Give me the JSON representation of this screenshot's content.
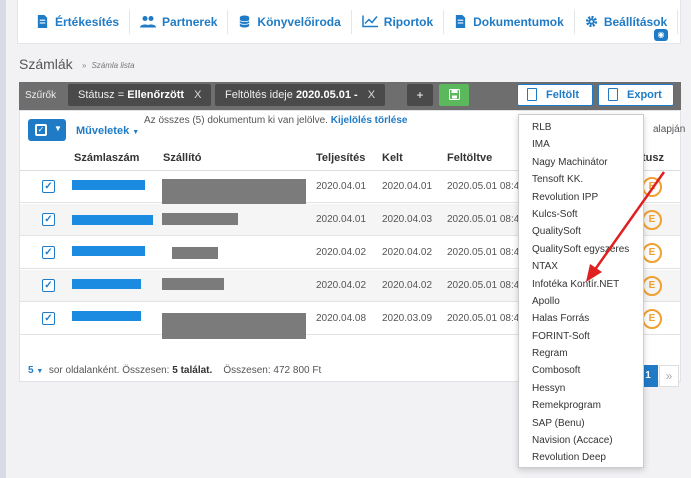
{
  "nav": {
    "items": [
      {
        "label": "Értékesítés",
        "icon": "document-icon"
      },
      {
        "label": "Partnerek",
        "icon": "users-icon"
      },
      {
        "label": "Könyvelőiroda",
        "icon": "database-icon"
      },
      {
        "label": "Riportok",
        "icon": "line-chart-icon"
      },
      {
        "label": "Dokumentumok",
        "icon": "document-icon"
      },
      {
        "label": "Beállítások",
        "icon": "gear-icon"
      }
    ]
  },
  "page": {
    "title": "Számlák",
    "breadcrumb": "Számla lista"
  },
  "filters": {
    "label": "Szűrők",
    "chip1": {
      "prefix": "Státusz = ",
      "value": "Ellenőrzött",
      "close": "X"
    },
    "chip2": {
      "prefix": "Feltöltés ideje ",
      "value": "2020.05.01 -",
      "close": "X"
    },
    "plus": "+",
    "upload_label": "Feltölt",
    "export_label": "Export"
  },
  "toolbar": {
    "actions_label": "Műveletek",
    "selection_info": "Az összes (5) dokumentum ki van jelölve.",
    "clear_selection": "Kijelölés törlése",
    "tail_text": "alapján"
  },
  "table": {
    "headers": {
      "number": "Számlaszám",
      "supplier": "Szállító",
      "fulfilment": "Teljesítés",
      "date": "Kelt",
      "uploaded": "Feltöltve",
      "status": "tusz"
    },
    "rows": [
      {
        "fulfilment": "2020.04.01",
        "date": "2020.04.01",
        "uploaded": "2020.05.01 08:4"
      },
      {
        "fulfilment": "2020.04.01",
        "date": "2020.04.03",
        "uploaded": "2020.05.01 08:4"
      },
      {
        "fulfilment": "2020.04.02",
        "date": "2020.04.02",
        "uploaded": "2020.05.01 08:4"
      },
      {
        "fulfilment": "2020.04.02",
        "date": "2020.04.02",
        "uploaded": "2020.05.01 08:4"
      },
      {
        "fulfilment": "2020.04.08",
        "date": "2020.03.09",
        "uploaded": "2020.05.01 08:4"
      }
    ],
    "status_glyph": "E"
  },
  "footer": {
    "page_size": "5",
    "per_page_text": "sor oldalanként. Összesen:",
    "total_results": "5 találat.",
    "sum_text": "Összesen: 472 800 Ft",
    "current_page": "1",
    "next": "»"
  },
  "dropdown": {
    "items": [
      "RLB",
      "IMA",
      "Nagy Machinátor",
      "Tensoft KK.",
      "Revolution IPP",
      "Kulcs-Soft",
      "QualitySoft",
      "QualitySoft egyszeres",
      "NTAX",
      "Infotéka Kontír.NET",
      "Apollo",
      "Halas Forrás",
      "FORINT-Soft",
      "Regram",
      "Combosoft",
      "Hessyn",
      "Remekprogram",
      "SAP (Benu)",
      "Navision (Accace)",
      "Revolution Deep"
    ]
  },
  "colors": {
    "accent": "#1f7bc6",
    "green": "#5cb85c",
    "filter_bg": "#6e6e6e",
    "status": "#f0a030",
    "arrow": "#e02020"
  }
}
